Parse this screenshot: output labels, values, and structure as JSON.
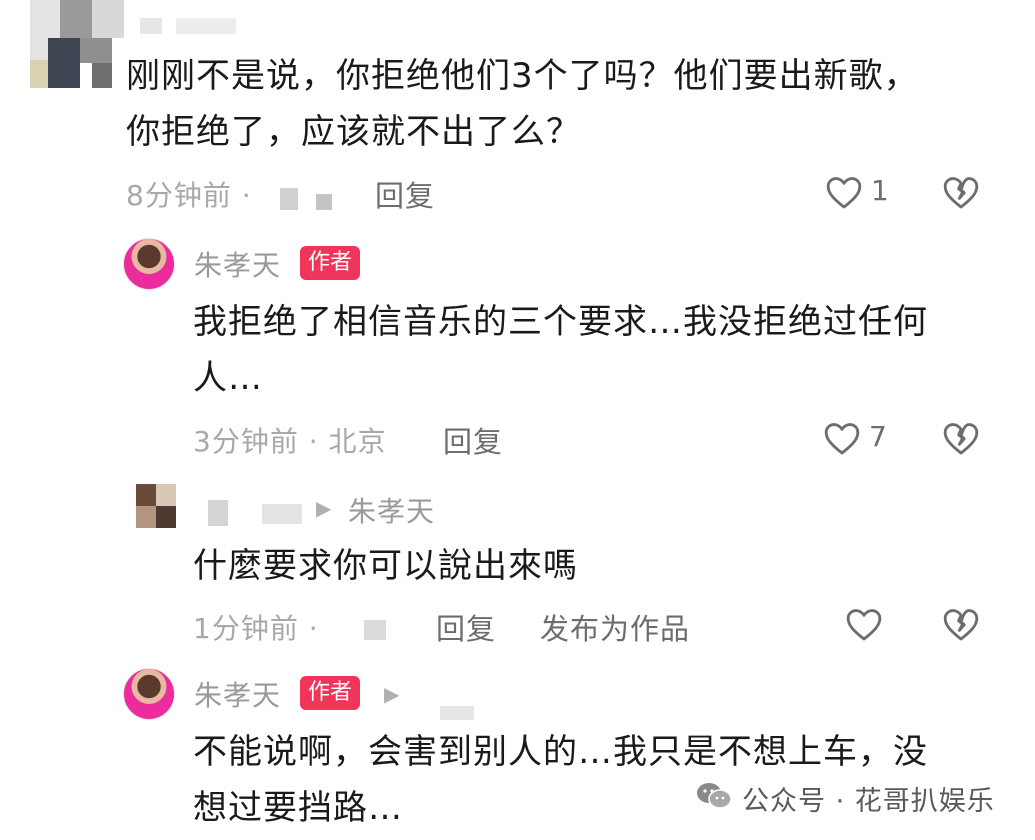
{
  "comments": [
    {
      "text": "刚刚不是说，你拒绝他们3个了吗？他们要出新歌，你拒绝了，应该就不出了么？",
      "line1": "刚刚不是说，你拒绝他们3个了吗？他们要出新歌，",
      "line2": "你拒绝了，应该就不出了么？",
      "time": "8分钟前 ·",
      "reply_label": "回复",
      "like_count": "1"
    },
    {
      "author": "朱孝天",
      "author_badge": "作者",
      "line1": "我拒绝了相信音乐的三个要求…我没拒绝过任何",
      "line2": "人…",
      "time": "3分钟前 · 北京",
      "reply_label": "回复",
      "like_count": "7"
    },
    {
      "reply_to": "朱孝天",
      "reply_arrow": "▶",
      "line1": "什麼要求你可以說出來嗎",
      "time": "1分钟前 ·",
      "reply_label": "回复",
      "publish_label": "发布为作品"
    },
    {
      "author": "朱孝天",
      "author_badge": "作者",
      "reply_arrow": "▶",
      "line1": "不能说啊，会害到别人的…我只是不想上车，没",
      "line2": "想过要挡路…"
    }
  ],
  "watermark": {
    "icon": "wechat-icon",
    "text": "公众号 · 花哥扒娱乐"
  },
  "colors": {
    "badge": "#f0345a",
    "meta_text": "#a8a8a8",
    "body_text": "#1a1a1a"
  }
}
